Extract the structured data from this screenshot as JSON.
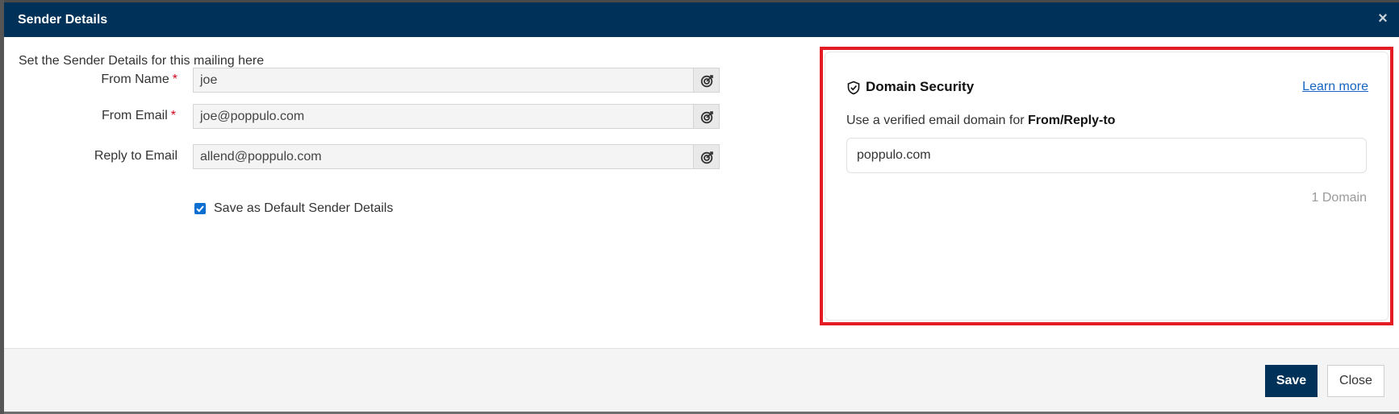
{
  "dialog": {
    "title": "Sender Details",
    "close_icon": "close-icon"
  },
  "form": {
    "intro": "Set the Sender Details for this mailing here",
    "fields": [
      {
        "label": "From Name",
        "required": true,
        "value": "joe",
        "action_icon": "target-icon"
      },
      {
        "label": "From Email",
        "required": true,
        "value": "joe@poppulo.com",
        "action_icon": "target-icon"
      },
      {
        "label": "Reply to Email",
        "required": false,
        "value": "allend@poppulo.com",
        "action_icon": "target-icon"
      }
    ],
    "required_marker": "*",
    "save_default": {
      "label": "Save as Default Sender Details",
      "checked": true
    }
  },
  "domain_security": {
    "icon": "shield-check-icon",
    "title": "Domain Security",
    "learn_more": "Learn more",
    "description_prefix": "Use a verified email domain for ",
    "description_bold": "From/Reply-to",
    "domain": "poppulo.com",
    "count": "1 Domain"
  },
  "footer": {
    "save_label": "Save",
    "close_label": "Close"
  },
  "colors": {
    "header_bg": "#003158",
    "highlight_border": "#e31b23",
    "link": "#1565c0",
    "checkbox": "#0a6fd0"
  }
}
